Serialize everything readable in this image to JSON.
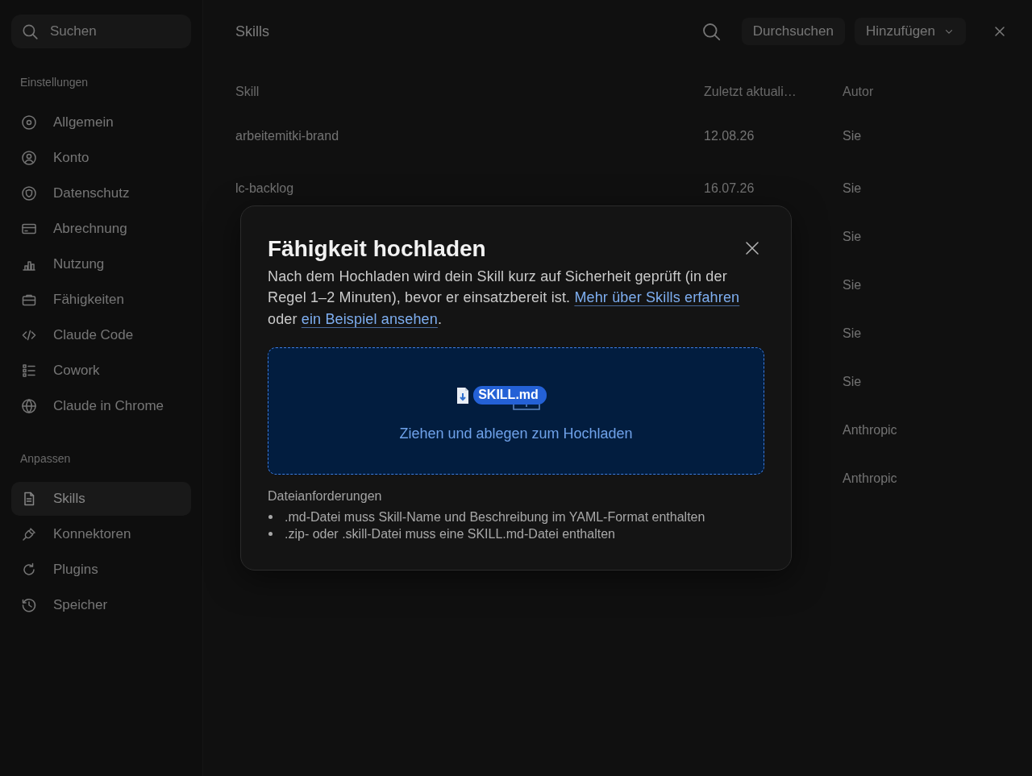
{
  "sidebar": {
    "search": {
      "placeholder": "Suchen"
    },
    "sections": [
      {
        "heading": "Einstellungen",
        "items": [
          {
            "label": "Allgemein",
            "selected": false
          },
          {
            "label": "Konto",
            "selected": false
          },
          {
            "label": "Datenschutz",
            "selected": false
          },
          {
            "label": "Abrechnung",
            "selected": false
          },
          {
            "label": "Nutzung",
            "selected": false
          },
          {
            "label": "Fähigkeiten",
            "selected": false
          },
          {
            "label": "Claude Code",
            "selected": false
          },
          {
            "label": "Cowork",
            "selected": false
          },
          {
            "label": "Claude in Chrome",
            "selected": false
          }
        ]
      },
      {
        "heading": "Anpassen",
        "items": [
          {
            "label": "Skills",
            "selected": true
          },
          {
            "label": "Konnektoren",
            "selected": false
          },
          {
            "label": "Plugins",
            "selected": false
          },
          {
            "label": "Speicher",
            "selected": false
          }
        ]
      }
    ]
  },
  "main": {
    "title": "Skills",
    "actions": [
      {
        "label": "Durchsuchen",
        "kind": "button"
      },
      {
        "label": "Hinzufügen",
        "kind": "dropdown"
      }
    ]
  },
  "table": {
    "columns": [
      "Skill",
      "Zuletzt aktuali…",
      "Autor"
    ],
    "rows": [
      {
        "skill": "arbeitemitki-brand",
        "updated": "12.08.26",
        "author": "Sie"
      },
      {
        "skill": "lc-backlog",
        "updated": "16.07.26",
        "author": "Sie"
      },
      {
        "author": "Sie"
      },
      {
        "author": "Sie"
      },
      {
        "author": "Sie"
      },
      {
        "author": "Sie"
      },
      {
        "author": "Anthropic"
      },
      {
        "author": "Anthropic"
      }
    ]
  },
  "modal": {
    "title": "Fähigkeit hochladen",
    "description": [
      {
        "kind": "text",
        "text": "Nach dem Hochladen wird dein Skill kurz auf Sicherheit geprüft (in der Regel 1–2 Minuten), bevor er einsatzbereit ist. "
      },
      {
        "kind": "link",
        "text": "Mehr über Skills erfahren"
      },
      {
        "kind": "text",
        "text": " oder "
      },
      {
        "kind": "link",
        "text": "ein Beispiel ansehen"
      },
      {
        "kind": "text",
        "text": "."
      }
    ],
    "dropzone": {
      "file_chip": "SKILL.md",
      "label": "Ziehen und ablegen zum Hochladen"
    },
    "requirements": {
      "heading": "Dateianforderungen",
      "items": [
        ".md-Datei muss Skill-Name und Beschreibung im YAML-Format enthalten",
        ".zip- oder .skill-Datei muss eine SKILL.md-Datei enthalten"
      ]
    }
  }
}
